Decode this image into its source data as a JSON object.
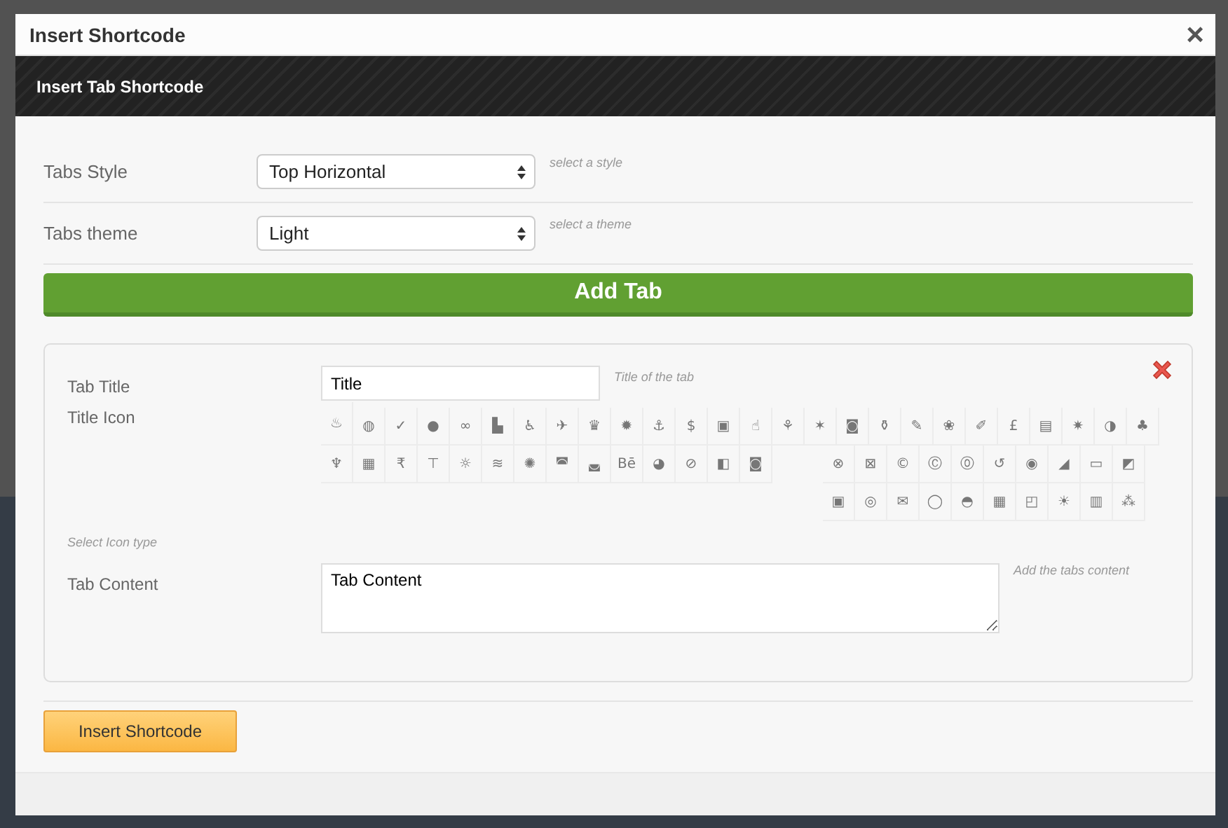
{
  "window": {
    "title": "Insert Shortcode",
    "close": "×"
  },
  "header": {
    "title": "Insert Tab Shortcode"
  },
  "settings": [
    {
      "label": "Tabs Style",
      "value": "Top Horizontal",
      "hint": "select a style"
    },
    {
      "label": "Tabs theme",
      "value": "Light",
      "hint": "select a theme"
    }
  ],
  "add_button": "Add Tab",
  "tab_panel": {
    "title_label": "Tab Title",
    "title_value": "Title",
    "title_hint": "Title of the tab",
    "icon_label": "Title Icon",
    "icon_hint": "Select Icon type",
    "icons_row": [
      "♨",
      "◍",
      "✓",
      "●",
      "∞",
      "▙",
      "♿",
      "✈",
      "♛",
      "✹",
      "⚓",
      "$",
      "▣",
      "☝",
      "⚘",
      "✶",
      "◙",
      "⚱",
      "✎",
      "❀",
      "✐",
      "£",
      "▤",
      "✷",
      "◑",
      "♣"
    ],
    "icons_left": [
      "♆",
      "▦",
      "₹",
      "⊤",
      "☼",
      "≋",
      "✺",
      "◚",
      "◛",
      "Bē",
      "◕",
      "⊘",
      "◧",
      "◙"
    ],
    "icons_right": [
      "⊗",
      "⊠",
      "©",
      "Ⓒ",
      "⓪",
      "↺",
      "◉",
      "◢",
      "▭",
      "◩",
      "▣",
      "◎",
      "✉",
      "◯",
      "◓",
      "▦",
      "◰",
      "☀",
      "▥",
      "⁂"
    ],
    "content_label": "Tab Content",
    "content_value": "Tab Content",
    "content_hint": "Add the tabs content"
  },
  "insert_button": "Insert Shortcode"
}
